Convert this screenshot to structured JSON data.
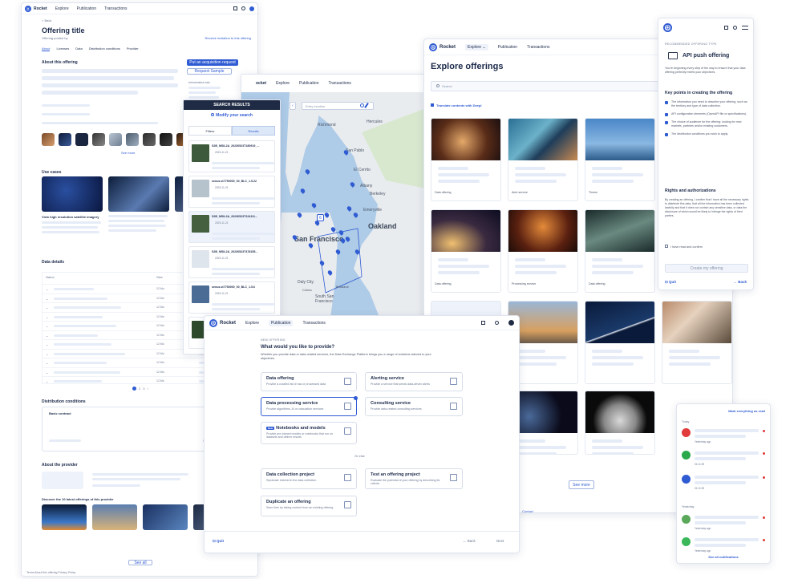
{
  "left_window": {
    "brand": "Rocket",
    "nav": [
      "Explore",
      "Publication",
      "Transactions"
    ],
    "back_label": "< Back",
    "title": "Offering title",
    "subtitle": "Offering posted by",
    "top_action": "Receive invitation to this offering",
    "tabs": [
      "About",
      "Licenses",
      "Data",
      "Distribution conditions",
      "Provider"
    ],
    "section_about": "About this offering",
    "request_button": "Put an acquisition request",
    "second_button": "Request Sample",
    "info_label": "Information tab",
    "use_cases_title": "Use cases",
    "use_case_heading": "View high resolution satellite imagery",
    "see_more": "See more",
    "data_details_title": "Data details",
    "data_col_name": "Name",
    "data_col_size": "Size",
    "sizes": [
      "12 Mo",
      "12 Mo",
      "12 Mo",
      "12 Mo",
      "12 Mo",
      "12 Mo",
      "12 Mo",
      "12 Mo",
      "12 Mo",
      "12 Mo",
      "12 Mo"
    ],
    "distribution_title": "Distribution conditions",
    "basic_contract": "Basic contract",
    "about_provider": "About the provider",
    "related_title": "Discover the 10 latest offerings of this provider",
    "see_all": "See all",
    "footer_links": "Terms   About this offering   Privacy Policy"
  },
  "search_panel": {
    "header": "SEARCH RESULTS",
    "modify": "Modify your search",
    "tabs": [
      "Filters",
      "Results"
    ],
    "results": [
      {
        "name": "S2B_MSIL2A_20230523T180919_...",
        "date": "2023-11-21"
      },
      {
        "name": "senus.st7750000_00_BLC_1.5.22",
        "date": "2023-11-21"
      },
      {
        "name": "S2B_MSIL2A_20230523T224111...",
        "date": "2023-11-21"
      },
      {
        "name": "S2B_MSIL2A_20230523T478155...",
        "date": "2023-11-21"
      },
      {
        "name": "senus.st7750000_00_BLC_1.5.6",
        "date": "2023-11-21"
      },
      {
        "name": "S2B_MSIL2A_20230523T220111...",
        "date": "2023-11-21"
      }
    ]
  },
  "map": {
    "search_placeholder": "Entry location",
    "nav": [
      "Explore",
      "Publication",
      "Transactions"
    ],
    "places": [
      "Richmond",
      "Hercules",
      "San Pablo",
      "El Cerrito",
      "Albany",
      "Berkeley",
      "Emeryville",
      "Oakland",
      "San Francisco",
      "Daly City",
      "South San Francisco",
      "Colma",
      "Brisbane"
    ],
    "cluster": "6"
  },
  "explore_window": {
    "brand": "Rocket",
    "nav": [
      "Explore",
      "Publication",
      "Transactions"
    ],
    "title": "Explore offerings",
    "search_placeholder": "Search",
    "translate_toggle": "Translate contents with Deepl",
    "card_tags": [
      "Data offering",
      "Alert service",
      "Theme",
      "Data offering",
      "Processing service",
      "Data offering"
    ],
    "see_more": "See more",
    "footer": "Contact"
  },
  "push_panel": {
    "kicker": "RECOMMENDED OFFERING TYPE",
    "title": "API push offering",
    "intro": "You're beginning every step of the way to ensure that your data offering perfectly meets your objectives.",
    "key_points_title": "Key points in creating the offering",
    "points": [
      "The information you need to describe your offering, such as the territory and type of data collection.",
      "API configuration elements (OpenAPI file or specifications).",
      "The choice of audience for the offering: looking for new markets, partners and/or existing customers.",
      "The distribution conditions you wish to apply."
    ],
    "rights_title": "Rights and authorizations",
    "rights_text": "By creating an offering, I confirm that I have all the necessary rights to distribute this data, that all the information has been collected lawfully and that it does not contain any sensitive data, or data the disclosure of which would be likely to infringe the rights of third parties.",
    "confirm_label": "I have read and confirm",
    "create_button": "Create my offering",
    "quit": "Quit",
    "back": "Back"
  },
  "provide_window": {
    "brand": "Rocket",
    "nav": [
      "Explore",
      "Publication",
      "Transactions"
    ],
    "kicker": "NEW OFFERING",
    "question": "What would you like to provide?",
    "intro": "Whether you provide data or data-related services, the Data Exchange Platform brings you a range of solutions tailored to your objectives.",
    "options": [
      {
        "title": "Data offering",
        "desc": "Provide a curated list of raw or processed data"
      },
      {
        "title": "Alerting service",
        "desc": "Provide a service that sends data-driven alerts"
      },
      {
        "title": "Data processing service",
        "desc": "Provide algorithms, AI or calculation services"
      },
      {
        "title": "Consulting service",
        "desc": "Provide data-related consulting services"
      },
      {
        "title": "Notebooks and models",
        "desc": "Provide pre-trained models or notebooks that run on datasets and deliver results"
      }
    ],
    "or_label": "Or else",
    "extra_options": [
      {
        "title": "Data collection project",
        "desc": "Syndicate interest in the data collection"
      },
      {
        "title": "Test an offering project",
        "desc": "Evaluate the potential of your offering by describing its criteria"
      },
      {
        "title": "Duplicate an offering",
        "desc": "Save time by taking content from an existing offering"
      }
    ],
    "new_badge": "New",
    "quit": "Quit",
    "back": "Back",
    "next": "Next"
  },
  "notifications": {
    "mark_all": "Mark everything as read",
    "group_today": "Today",
    "group_yesterday": "Yesterday",
    "times": [
      "Yesterday ago",
      "01:11:09",
      "01:11:09",
      "Yesterday ago",
      "Yesterday ago"
    ],
    "see_all": "See all notifications"
  }
}
